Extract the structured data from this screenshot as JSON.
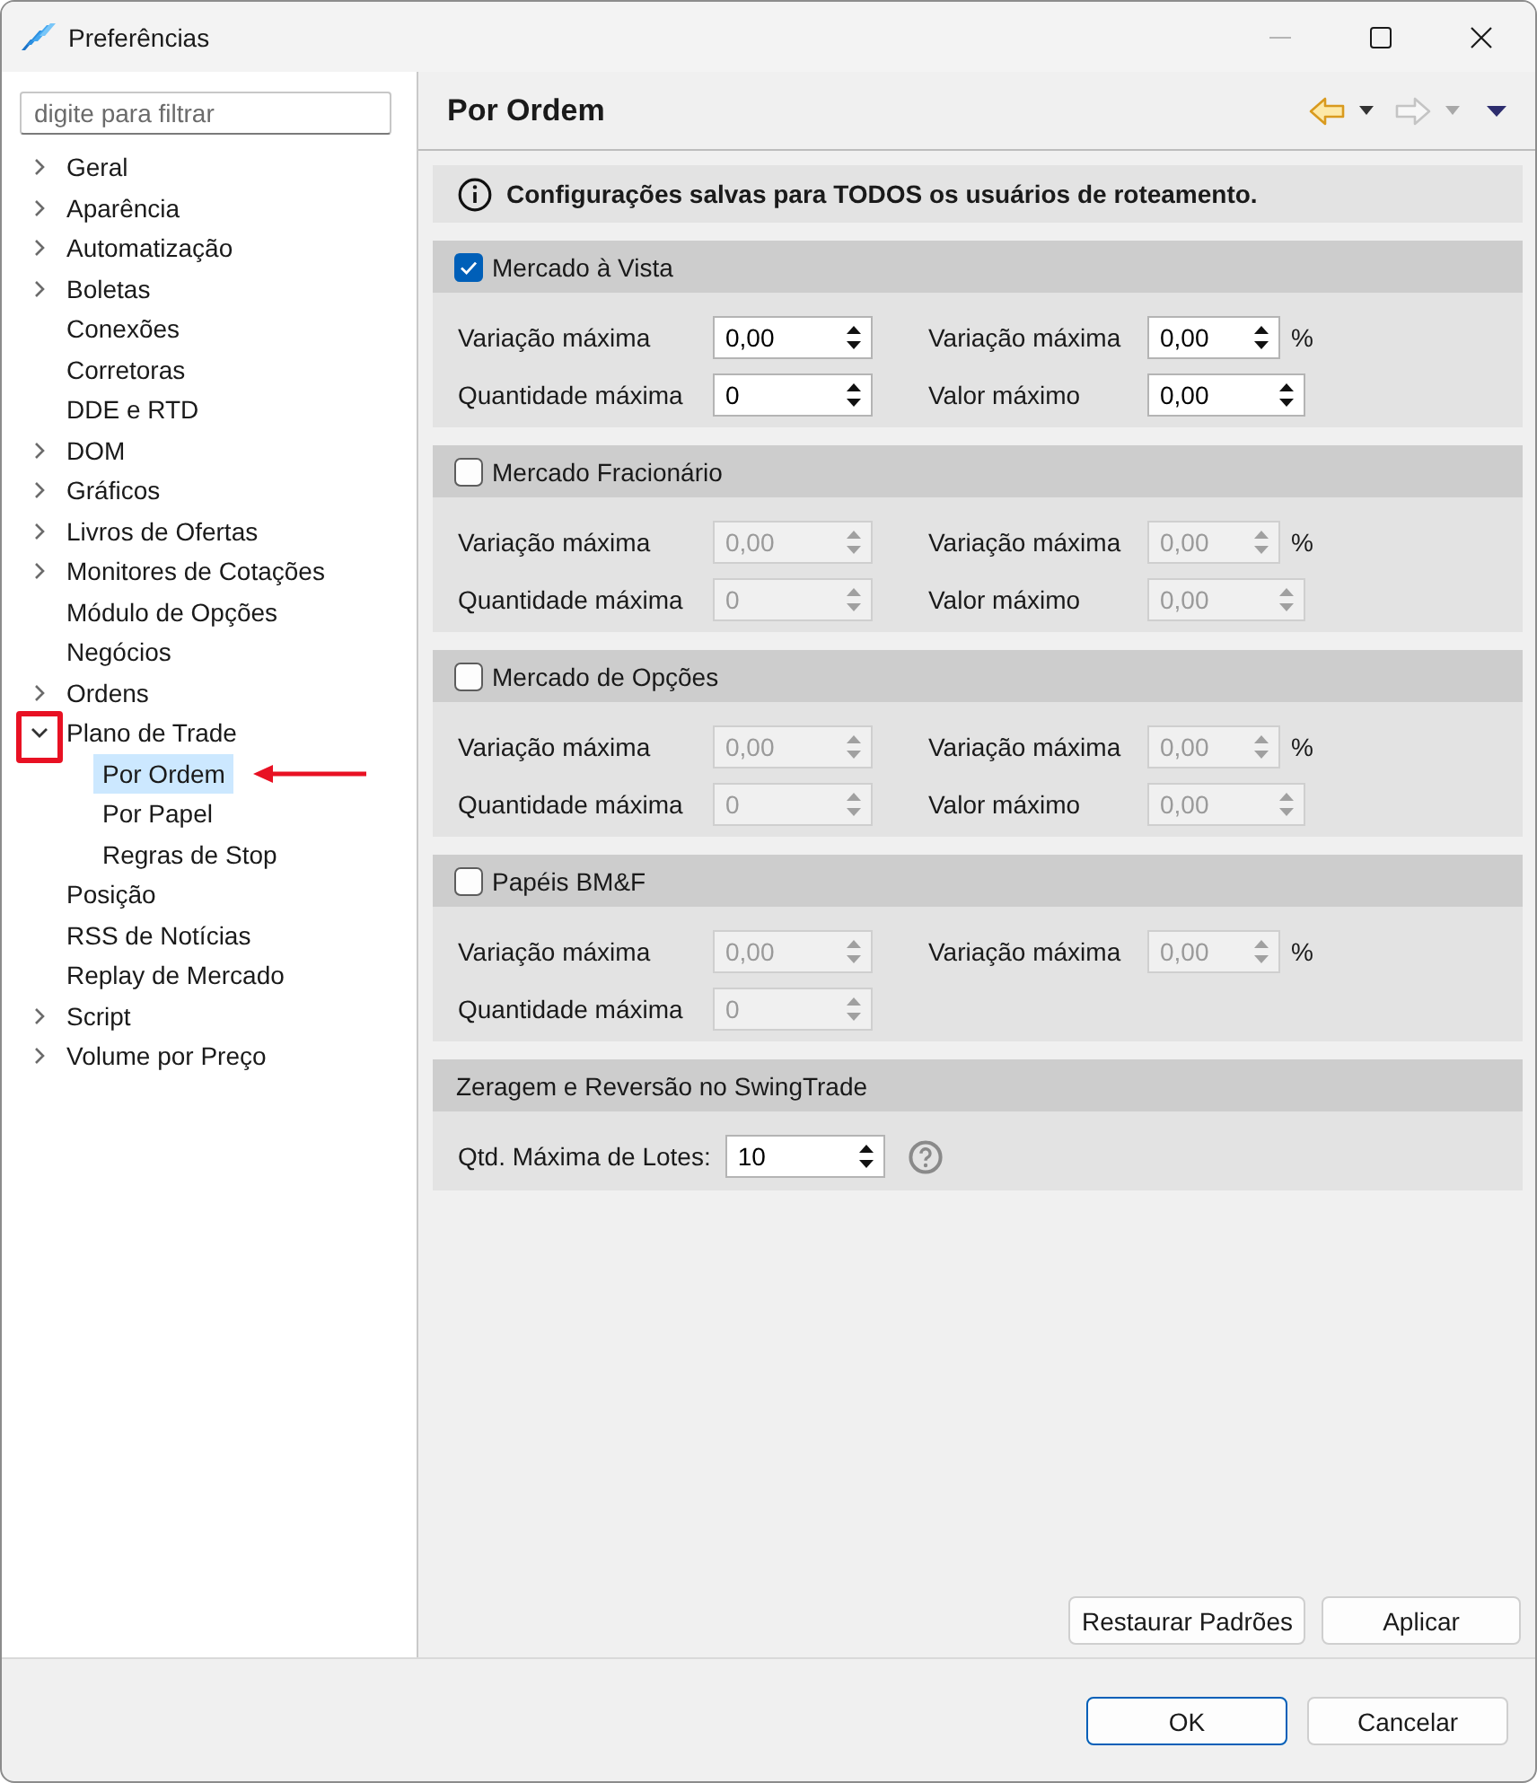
{
  "window": {
    "title": "Preferências",
    "controls": [
      {
        "kind": "minimize",
        "disabled": true
      },
      {
        "kind": "maximize",
        "disabled": false
      },
      {
        "kind": "close",
        "disabled": false
      }
    ]
  },
  "sidebar": {
    "filter": {
      "placeholder": "digite para filtrar"
    },
    "items": [
      {
        "label": "Geral",
        "expandable": true,
        "expanded": false,
        "selected": false
      },
      {
        "label": "Aparência",
        "expandable": true,
        "expanded": false,
        "selected": false
      },
      {
        "label": "Automatização",
        "expandable": true,
        "expanded": false,
        "selected": false
      },
      {
        "label": "Boletas",
        "expandable": true,
        "expanded": false,
        "selected": false
      },
      {
        "label": "Conexões",
        "expandable": false,
        "selected": false
      },
      {
        "label": "Corretoras",
        "expandable": false,
        "selected": false
      },
      {
        "label": "DDE e RTD",
        "expandable": false,
        "selected": false
      },
      {
        "label": "DOM",
        "expandable": true,
        "expanded": false,
        "selected": false
      },
      {
        "label": "Gráficos",
        "expandable": true,
        "expanded": false,
        "selected": false
      },
      {
        "label": "Livros de Ofertas",
        "expandable": true,
        "expanded": false,
        "selected": false
      },
      {
        "label": "Monitores de Cotações",
        "expandable": true,
        "expanded": false,
        "selected": false
      },
      {
        "label": "Módulo de Opções",
        "expandable": false,
        "selected": false
      },
      {
        "label": "Negócios",
        "expandable": false,
        "selected": false
      },
      {
        "label": "Ordens",
        "expandable": true,
        "expanded": false,
        "selected": false
      },
      {
        "label": "Plano de Trade",
        "expandable": true,
        "expanded": true,
        "selected": false,
        "boxed": true,
        "children": [
          {
            "label": "Por Ordem",
            "expandable": false,
            "selected": true,
            "arrow": true
          },
          {
            "label": "Por Papel",
            "expandable": false,
            "selected": false
          },
          {
            "label": "Regras de Stop",
            "expandable": false,
            "selected": false
          }
        ]
      },
      {
        "label": "Posição",
        "expandable": false,
        "selected": false
      },
      {
        "label": "RSS de Notícias",
        "expandable": false,
        "selected": false
      },
      {
        "label": "Replay de Mercado",
        "expandable": false,
        "selected": false
      },
      {
        "label": "Script",
        "expandable": true,
        "expanded": false,
        "selected": false
      },
      {
        "label": "Volume por Preço",
        "expandable": true,
        "expanded": false,
        "selected": false
      }
    ]
  },
  "page": {
    "title": "Por Ordem",
    "toolbar": [
      {
        "kind": "back",
        "disabled": false
      },
      {
        "kind": "forward",
        "disabled": true
      },
      {
        "kind": "menu",
        "disabled": false
      }
    ]
  },
  "notice": "Configurações salvas para TODOS os usuários de roteamento.",
  "sections": [
    {
      "kind": "checkable",
      "title": "Mercado à Vista",
      "checked": true,
      "rows": [
        {
          "left": {
            "label": "Variação máxima",
            "value": "0,00",
            "disabled": false
          },
          "right": {
            "label": "Variação máxima",
            "value": "0,00",
            "disabled": false,
            "unit": "%"
          }
        },
        {
          "left": {
            "label": "Quantidade máxima",
            "value": "0",
            "disabled": false
          },
          "right": {
            "label": "Valor máximo",
            "value": "0,00",
            "disabled": false
          }
        }
      ]
    },
    {
      "kind": "checkable",
      "title": "Mercado Fracionário",
      "checked": false,
      "rows": [
        {
          "left": {
            "label": "Variação máxima",
            "value": "0,00",
            "disabled": true
          },
          "right": {
            "label": "Variação máxima",
            "value": "0,00",
            "disabled": true,
            "unit": "%"
          }
        },
        {
          "left": {
            "label": "Quantidade máxima",
            "value": "0",
            "disabled": true
          },
          "right": {
            "label": "Valor máximo",
            "value": "0,00",
            "disabled": true
          }
        }
      ]
    },
    {
      "kind": "checkable",
      "title": "Mercado de Opções",
      "checked": false,
      "rows": [
        {
          "left": {
            "label": "Variação máxima",
            "value": "0,00",
            "disabled": true
          },
          "right": {
            "label": "Variação máxima",
            "value": "0,00",
            "disabled": true,
            "unit": "%"
          }
        },
        {
          "left": {
            "label": "Quantidade máxima",
            "value": "0",
            "disabled": true
          },
          "right": {
            "label": "Valor máximo",
            "value": "0,00",
            "disabled": true
          }
        }
      ]
    },
    {
      "kind": "checkable",
      "title": "Papéis BM&F",
      "checked": false,
      "rows": [
        {
          "left": {
            "label": "Variação máxima",
            "value": "0,00",
            "disabled": true
          },
          "right": {
            "label": "Variação máxima",
            "value": "0,00",
            "disabled": true,
            "unit": "%"
          }
        },
        {
          "left": {
            "label": "Quantidade máxima",
            "value": "0",
            "disabled": true
          }
        }
      ]
    },
    {
      "kind": "plain",
      "title": "Zeragem e Reversão no SwingTrade",
      "rows": [
        {
          "left": {
            "label": "Qtd. Máxima de Lotes:",
            "value": "10",
            "disabled": false,
            "help": true
          }
        }
      ]
    }
  ],
  "page_buttons": [
    {
      "label": "Restaurar Padrões"
    },
    {
      "label": "Aplicar"
    }
  ],
  "dialog_buttons": [
    {
      "label": "OK",
      "default": true
    },
    {
      "label": "Cancelar",
      "default": false
    }
  ]
}
